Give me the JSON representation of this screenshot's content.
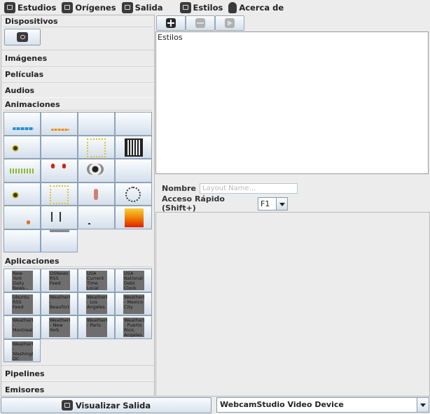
{
  "menu": [
    {
      "label": "Estudios",
      "icon": "studio-icon"
    },
    {
      "label": "Orígenes",
      "icon": "sources-icon"
    },
    {
      "label": "Salida",
      "icon": "output-icon"
    },
    {
      "label": "Estilos",
      "icon": "styles-icon"
    },
    {
      "label": "Acerca de",
      "icon": "bulb-icon"
    }
  ],
  "left": {
    "dispositivos": "Dispositivos",
    "imagenes": "Imágenes",
    "peliculas": "Películas",
    "audios": "Audios",
    "animaciones": "Animaciones",
    "aplicaciones": "Aplicaciones",
    "pipelines": "Pipelines",
    "emisores": "Emisores",
    "apps": [
      "New York Daily News - Photo",
      "OSNews RSS Feed",
      "USA Current Time Local",
      "USA National Debt Clock",
      "Ubuntu RSS Feed",
      "WeatherBug - Beaufort",
      "WeatherBug - Los Angeles",
      "WeatherBug - Mexico City",
      "WeatherBug - Montreal",
      "WeatherBug - New York",
      "WeatherBug - Paris",
      "WeatherBug - Puerto Rico, Angeles",
      "WeatherBug - Washington DC"
    ]
  },
  "right": {
    "styles_label": "Estilos",
    "nombre_label": "Nombre",
    "nombre_placeholder": "Layout Name...",
    "acceso_label": "Acceso Rápido (Shift+)",
    "acceso_value": "F1"
  },
  "bottom": {
    "visualizar": "Visualizar Salida",
    "device": "WebcamStudio Video Device"
  }
}
